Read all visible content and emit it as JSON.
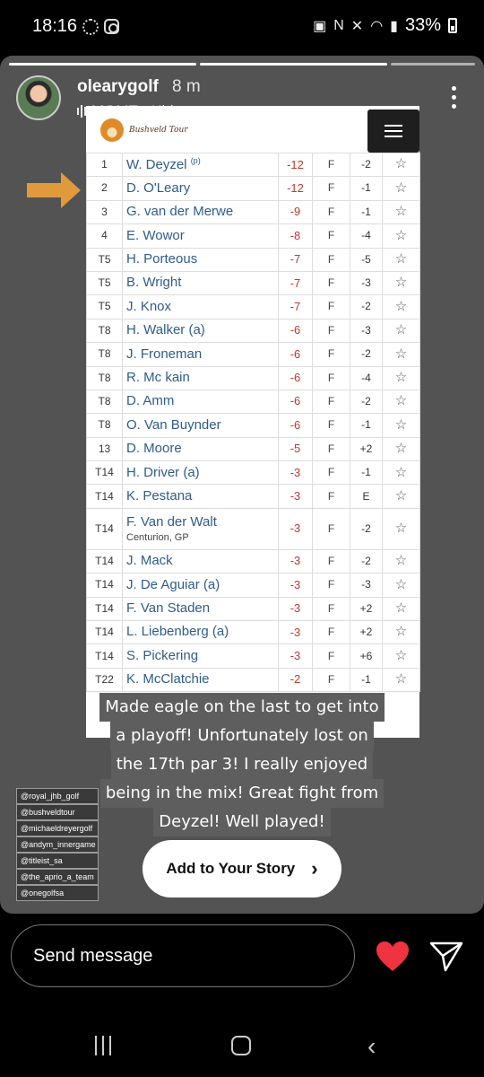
{
  "status_bar": {
    "time": "18:16",
    "battery_text": "33%"
  },
  "story": {
    "username": "olearygolf",
    "time_ago": "8 m",
    "music": "MGMT • Kids",
    "board": {
      "logo_text": "Bushveld Tour",
      "rows": [
        {
          "pos": "1",
          "name": "W. Deyzel",
          "sup": "(p)",
          "score": "-12",
          "thru": "F",
          "today": "-2"
        },
        {
          "pos": "2",
          "name": "D. O'Leary",
          "score": "-12",
          "thru": "F",
          "today": "-1"
        },
        {
          "pos": "3",
          "name": "G. van der Merwe",
          "score": "-9",
          "thru": "F",
          "today": "-1"
        },
        {
          "pos": "4",
          "name": "E. Wowor",
          "score": "-8",
          "thru": "F",
          "today": "-4"
        },
        {
          "pos": "T5",
          "name": "H. Porteous",
          "score": "-7",
          "thru": "F",
          "today": "-5"
        },
        {
          "pos": "T5",
          "name": "B. Wright",
          "score": "-7",
          "thru": "F",
          "today": "-3"
        },
        {
          "pos": "T5",
          "name": "J. Knox",
          "score": "-7",
          "thru": "F",
          "today": "-2"
        },
        {
          "pos": "T8",
          "name": "H. Walker (a)",
          "score": "-6",
          "thru": "F",
          "today": "-3"
        },
        {
          "pos": "T8",
          "name": "J. Froneman",
          "score": "-6",
          "thru": "F",
          "today": "-2"
        },
        {
          "pos": "T8",
          "name": "R. Mc kain",
          "score": "-6",
          "thru": "F",
          "today": "-4"
        },
        {
          "pos": "T8",
          "name": "D. Amm",
          "score": "-6",
          "thru": "F",
          "today": "-2"
        },
        {
          "pos": "T8",
          "name": "O. Van Buynder",
          "score": "-6",
          "thru": "F",
          "today": "-1"
        },
        {
          "pos": "13",
          "name": "D. Moore",
          "score": "-5",
          "thru": "F",
          "today": "+2"
        },
        {
          "pos": "T14",
          "name": "H. Driver (a)",
          "score": "-3",
          "thru": "F",
          "today": "-1"
        },
        {
          "pos": "T14",
          "name": "K. Pestana",
          "score": "-3",
          "thru": "F",
          "today": "E"
        },
        {
          "pos": "T14",
          "name": "F. Van der Walt",
          "sub": "Centurion, GP",
          "score": "-3",
          "thru": "F",
          "today": "-2"
        },
        {
          "pos": "T14",
          "name": "J. Mack",
          "score": "-3",
          "thru": "F",
          "today": "-2"
        },
        {
          "pos": "T14",
          "name": "J. De Aguiar (a)",
          "score": "-3",
          "thru": "F",
          "today": "-3"
        },
        {
          "pos": "T14",
          "name": "F. Van Staden",
          "score": "-3",
          "thru": "F",
          "today": "+2"
        },
        {
          "pos": "T14",
          "name": "L. Liebenberg (a)",
          "score": "-3",
          "thru": "F",
          "today": "+2"
        },
        {
          "pos": "T14",
          "name": "S. Pickering",
          "score": "-3",
          "thru": "F",
          "today": "+6"
        },
        {
          "pos": "T22",
          "name": "K. McClatchie",
          "score": "-2",
          "thru": "F",
          "today": "-1"
        }
      ]
    },
    "caption_lines": [
      "Made eagle on the last to get into",
      "a playoff! Unfortunately lost on",
      "the 17th par 3! I really enjoyed",
      "being in the mix! Great fight from",
      "Deyzel! Well played!"
    ],
    "mentions": [
      "@royal_jhb_golf",
      "@bushveldtour",
      "@michaeldreyergolf",
      "@andym_innergame",
      "@titleist_sa",
      "@the_aprio_a_team",
      "@onegolfsa"
    ],
    "add_story_label": "Add to Your Story"
  },
  "reply_bar": {
    "placeholder": "Send message"
  },
  "colors": {
    "story_bg": "#535353",
    "heart": "#ef3340",
    "score_red": "#c0392b",
    "name_blue": "#2f5c8a",
    "arrow_orange": "#f0a23a"
  }
}
